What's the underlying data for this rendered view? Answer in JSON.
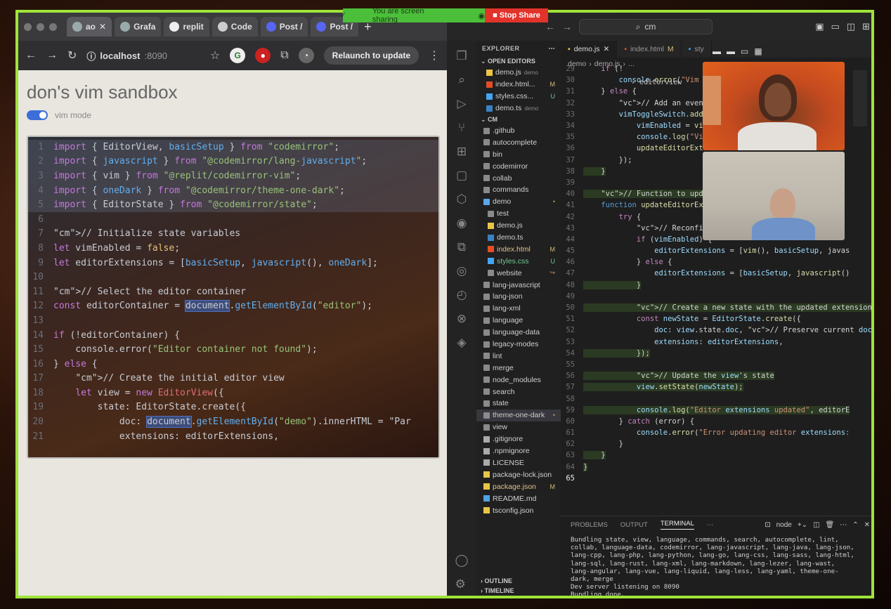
{
  "screen_share": {
    "message": "You are screen sharing",
    "stop_label": "Stop Share"
  },
  "browser": {
    "tabs": [
      {
        "label": "ao"
      },
      {
        "label": "Grafa"
      },
      {
        "label": "replit"
      },
      {
        "label": "Code"
      },
      {
        "label": "Post /"
      },
      {
        "label": "Post /"
      }
    ],
    "url_host": "localhost",
    "url_port": ":8090",
    "relaunch_label": "Relaunch to update",
    "page_title": "don's vim sandbox",
    "vim_toggle_label": "vim mode"
  },
  "browser_code": [
    {
      "n": "1",
      "t": "import { EditorView, basicSetup } from \"codemirror\";"
    },
    {
      "n": "2",
      "t": "import { javascript } from \"@codemirror/lang-javascript\";"
    },
    {
      "n": "3",
      "t": "import { vim } from \"@replit/codemirror-vim\";"
    },
    {
      "n": "4",
      "t": "import { oneDark } from \"@codemirror/theme-one-dark\";"
    },
    {
      "n": "5",
      "t": "import { EditorState } from \"@codemirror/state\";"
    },
    {
      "n": "6",
      "t": ""
    },
    {
      "n": "7",
      "t": "// Initialize state variables"
    },
    {
      "n": "8",
      "t": "let vimEnabled = false;"
    },
    {
      "n": "9",
      "t": "let editorExtensions = [basicSetup, javascript(), oneDark];"
    },
    {
      "n": "10",
      "t": ""
    },
    {
      "n": "11",
      "t": "// Select the editor container"
    },
    {
      "n": "12",
      "t": "const editorContainer = document.getElementById(\"editor\");"
    },
    {
      "n": "13",
      "t": ""
    },
    {
      "n": "14",
      "t": "if (!editorContainer) {"
    },
    {
      "n": "15",
      "t": "    console.error(\"Editor container not found\");"
    },
    {
      "n": "16",
      "t": "} else {"
    },
    {
      "n": "17",
      "t": "    // Create the initial editor view"
    },
    {
      "n": "18",
      "t": "    let view = new EditorView({"
    },
    {
      "n": "19",
      "t": "        state: EditorState.create({"
    },
    {
      "n": "20",
      "t": "            doc: document.getElementById(\"demo\").innerHTML = \"Par"
    },
    {
      "n": "21",
      "t": "            extensions: editorExtensions,"
    }
  ],
  "vscode": {
    "search_text": "cm",
    "explorer_title": "EXPLORER",
    "open_editors_label": "OPEN EDITORS",
    "open_editors": [
      {
        "name": "demo.js",
        "extra": "demo",
        "badge": ""
      },
      {
        "name": "index.html...",
        "extra": "",
        "badge": "M"
      },
      {
        "name": "styles.css...",
        "extra": "",
        "badge": "U"
      },
      {
        "name": "demo.ts",
        "extra": "demo",
        "badge": ""
      }
    ],
    "root_label": "CM",
    "tree": [
      {
        "name": ".github",
        "type": "folder",
        "indent": 1,
        "badge": ""
      },
      {
        "name": "autocomplete",
        "type": "folder",
        "indent": 1,
        "badge": ""
      },
      {
        "name": "bin",
        "type": "folder",
        "indent": 1,
        "badge": ""
      },
      {
        "name": "codemirror",
        "type": "folder",
        "indent": 1,
        "badge": ""
      },
      {
        "name": "collab",
        "type": "folder",
        "indent": 1,
        "badge": ""
      },
      {
        "name": "commands",
        "type": "folder",
        "indent": 1,
        "badge": ""
      },
      {
        "name": "demo",
        "type": "folder-open",
        "indent": 1,
        "badge": "•"
      },
      {
        "name": "test",
        "type": "folder",
        "indent": 2,
        "badge": ""
      },
      {
        "name": "demo.js",
        "type": "js",
        "indent": 2,
        "badge": ""
      },
      {
        "name": "demo.ts",
        "type": "ts",
        "indent": 2,
        "badge": ""
      },
      {
        "name": "index.html",
        "type": "html",
        "indent": 2,
        "badge": "M"
      },
      {
        "name": "styles.css",
        "type": "css",
        "indent": 2,
        "badge": "U"
      },
      {
        "name": "website",
        "type": "folder",
        "indent": 2,
        "badge": "↪"
      },
      {
        "name": "lang-javascript",
        "type": "folder",
        "indent": 1,
        "badge": ""
      },
      {
        "name": "lang-json",
        "type": "folder",
        "indent": 1,
        "badge": ""
      },
      {
        "name": "lang-xml",
        "type": "folder",
        "indent": 1,
        "badge": ""
      },
      {
        "name": "language",
        "type": "folder",
        "indent": 1,
        "badge": ""
      },
      {
        "name": "language-data",
        "type": "folder",
        "indent": 1,
        "badge": ""
      },
      {
        "name": "legacy-modes",
        "type": "folder",
        "indent": 1,
        "badge": ""
      },
      {
        "name": "lint",
        "type": "folder",
        "indent": 1,
        "badge": ""
      },
      {
        "name": "merge",
        "type": "folder",
        "indent": 1,
        "badge": ""
      },
      {
        "name": "node_modules",
        "type": "folder",
        "indent": 1,
        "badge": ""
      },
      {
        "name": "search",
        "type": "folder",
        "indent": 1,
        "badge": ""
      },
      {
        "name": "state",
        "type": "folder",
        "indent": 1,
        "badge": ""
      },
      {
        "name": "theme-one-dark",
        "type": "folder",
        "indent": 1,
        "badge": "•"
      },
      {
        "name": "view",
        "type": "folder",
        "indent": 1,
        "badge": ""
      },
      {
        "name": ".gitignore",
        "type": "file",
        "indent": 1,
        "badge": ""
      },
      {
        "name": ".npmignore",
        "type": "file",
        "indent": 1,
        "badge": ""
      },
      {
        "name": "LICENSE",
        "type": "file",
        "indent": 1,
        "badge": ""
      },
      {
        "name": "package-lock.json",
        "type": "json",
        "indent": 1,
        "badge": ""
      },
      {
        "name": "package.json",
        "type": "json",
        "indent": 1,
        "badge": "M"
      },
      {
        "name": "README.md",
        "type": "md",
        "indent": 1,
        "badge": ""
      },
      {
        "name": "tsconfig.json",
        "type": "json",
        "indent": 1,
        "badge": ""
      }
    ],
    "outline_label": "OUTLINE",
    "timeline_label": "TIMELINE",
    "editor_tabs": [
      {
        "name": "demo.js",
        "badge": ""
      },
      {
        "name": "index.html",
        "badge": "M"
      },
      {
        "name": "sty",
        "badge": ""
      }
    ],
    "breadcrumb": [
      "demo",
      "demo.js",
      "..."
    ],
    "sticky_scope": "editorview",
    "panel_tabs": [
      "PROBLEMS",
      "OUTPUT",
      "TERMINAL"
    ],
    "terminal_name": "node",
    "terminal_lines": [
      "Bundling state, view, language, commands, search, autocomplete, lint, collab, language-data, codemirror, lang-javascript, lang-java, lang-json, lang-cpp, lang-php, lang-python, lang-go, lang-css, lang-sass, lang-html, lang-sql, lang-rust, lang-xml, lang-markdown, lang-lezer, lang-wast, lang-angular, lang-vue, lang-liquid, lang-less, lang-yaml, theme-one-dark, merge",
      "Dev server listening on 8090",
      "Bundling done."
    ]
  },
  "vscode_code": [
    {
      "n": "29",
      "t": "    if (!"
    },
    {
      "n": "30",
      "t": "        console.error(\"Vim t"
    },
    {
      "n": "31",
      "t": "    } else {"
    },
    {
      "n": "32",
      "t": "        // Add an event list"
    },
    {
      "n": "33",
      "t": "        vimToggleSwitch.addE"
    },
    {
      "n": "34",
      "t": "            vimEnabled = vim"
    },
    {
      "n": "35",
      "t": "            console.log(\"Vim"
    },
    {
      "n": "36",
      "t": "            updateEditorExte"
    },
    {
      "n": "37",
      "t": "        });"
    },
    {
      "n": "38",
      "t": "    }"
    },
    {
      "n": "39",
      "t": ""
    },
    {
      "n": "40",
      "t": "    // Function to update ed"
    },
    {
      "n": "41",
      "t": "    function updateEditorExt"
    },
    {
      "n": "42",
      "t": "        try {"
    },
    {
      "n": "43",
      "t": "            // Reconfigure e"
    },
    {
      "n": "44",
      "t": "            if (vimEnabled) {"
    },
    {
      "n": "45",
      "t": "                editorExtensions = [vim(), basicSetup, javas"
    },
    {
      "n": "46",
      "t": "            } else {"
    },
    {
      "n": "47",
      "t": "                editorExtensions = [basicSetup, javascript()"
    },
    {
      "n": "48",
      "t": "            }"
    },
    {
      "n": "49",
      "t": ""
    },
    {
      "n": "50",
      "t": "            // Create a new state with the updated extension"
    },
    {
      "n": "51",
      "t": "            const newState = EditorState.create({"
    },
    {
      "n": "52",
      "t": "                doc: view.state.doc, // Preserve current doc"
    },
    {
      "n": "53",
      "t": "                extensions: editorExtensions,"
    },
    {
      "n": "54",
      "t": "            });"
    },
    {
      "n": "55",
      "t": ""
    },
    {
      "n": "56",
      "t": "            // Update the view's state"
    },
    {
      "n": "57",
      "t": "            view.setState(newState);"
    },
    {
      "n": "58",
      "t": ""
    },
    {
      "n": "59",
      "t": "            console.log(\"Editor extensions updated\", editorE"
    },
    {
      "n": "60",
      "t": "        } catch (error) {"
    },
    {
      "n": "61",
      "t": "            console.error(\"Error updating editor extensions:"
    },
    {
      "n": "62",
      "t": "        }"
    },
    {
      "n": "63",
      "t": "    }"
    },
    {
      "n": "64",
      "t": "}"
    },
    {
      "n": "65",
      "t": ""
    }
  ],
  "colors": {
    "monitor_border": "#9fe43a",
    "share_green": "#4bbf3a",
    "share_red": "#e2332b",
    "toggle_blue": "#3c6fd8"
  }
}
